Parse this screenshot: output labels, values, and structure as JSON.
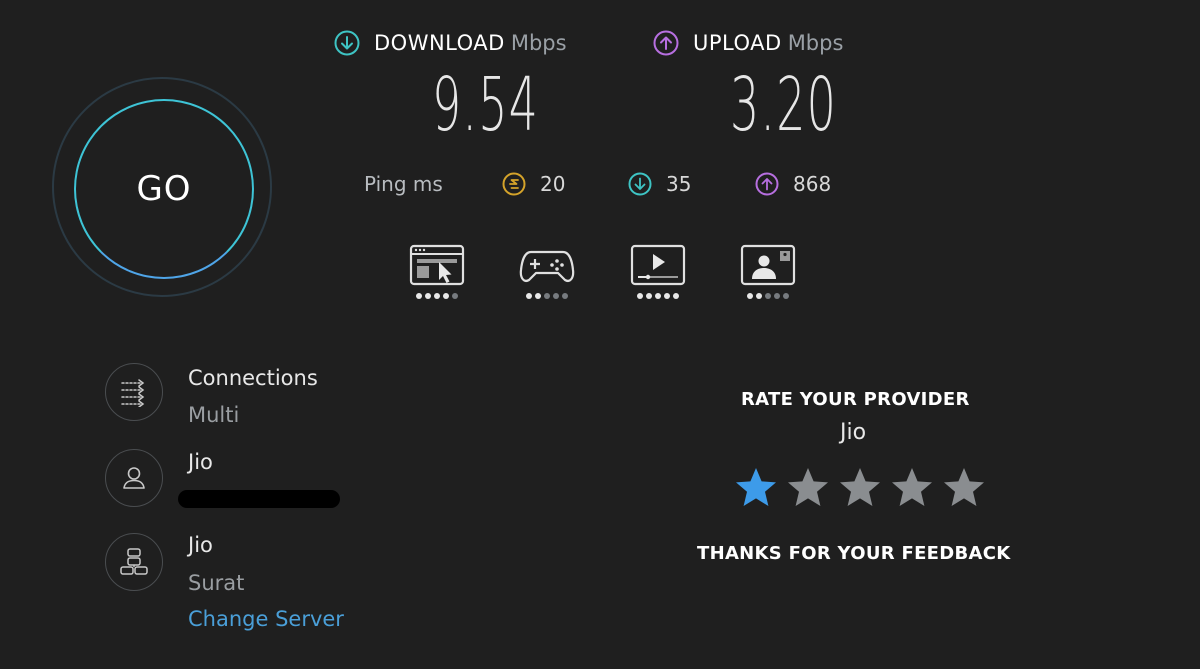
{
  "go_button": {
    "label": "GO"
  },
  "download": {
    "label": "DOWNLOAD",
    "unit": "Mbps",
    "value": "9.54",
    "color": "#3ec4c4"
  },
  "upload": {
    "label": "UPLOAD",
    "unit": "Mbps",
    "value": "3.20",
    "color": "#b76fe0"
  },
  "ping": {
    "label": "Ping ms",
    "idle": {
      "value": "20",
      "icon": "ping-jitter-icon",
      "color": "#d4a32a"
    },
    "download": {
      "value": "35",
      "icon": "download-arrow-icon",
      "color": "#3ec4c4"
    },
    "upload": {
      "value": "868",
      "icon": "upload-arrow-icon",
      "color": "#b76fe0"
    }
  },
  "quality_ratings": [
    {
      "icon": "web-browsing-icon",
      "level": 4,
      "max": 5
    },
    {
      "icon": "gaming-controller-icon",
      "level": 2,
      "max": 5
    },
    {
      "icon": "video-streaming-icon",
      "level": 5,
      "max": 5
    },
    {
      "icon": "video-call-icon",
      "level": 2,
      "max": 5
    }
  ],
  "connections": {
    "title": "Connections",
    "value": "Multi"
  },
  "provider_info": {
    "name": "Jio"
  },
  "server": {
    "name": "Jio",
    "location": "Surat",
    "change_label": "Change Server"
  },
  "rating": {
    "title": "RATE YOUR PROVIDER",
    "provider": "Jio",
    "stars_selected": 1,
    "stars_total": 5,
    "thanks": "THANKS FOR YOUR FEEDBACK",
    "active_color": "#3d9be9",
    "inactive_color": "#8a8d90"
  }
}
